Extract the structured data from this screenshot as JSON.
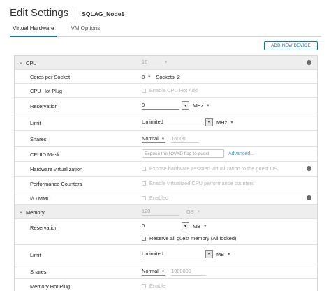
{
  "header": {
    "title": "Edit Settings",
    "vm_name": "SQLAG_Node1"
  },
  "tabs": [
    {
      "label": "Virtual Hardware",
      "active": true
    },
    {
      "label": "VM Options",
      "active": false
    }
  ],
  "add_device_label": "ADD NEW DEVICE",
  "cpu": {
    "section_label": "CPU",
    "count": "16",
    "cores_label": "Cores per Socket",
    "cores_value": "8",
    "sockets_text": "Sockets: 2",
    "hotplug_label": "CPU Hot Plug",
    "hotplug_text": "Enable CPU Hot Add",
    "reservation_label": "Reservation",
    "reservation_value": "0",
    "reservation_unit": "MHz",
    "limit_label": "Limit",
    "limit_value": "Unlimited",
    "limit_unit": "MHz",
    "shares_label": "Shares",
    "shares_value": "Normal",
    "shares_number": "16000",
    "cpuid_label": "CPUID Mask",
    "cpuid_text": "Expose the NX/XD flag to guest",
    "cpuid_link": "Advanced...",
    "hwvirt_label": "Hardware virtualization",
    "hwvirt_text": "Expose hardware assisted virtualization to the guest OS",
    "perf_label": "Performance Counters",
    "perf_text": "Enable virtualized CPU performance counters",
    "iommu_label": "I/O MMU",
    "iommu_text": "Enabled"
  },
  "memory": {
    "section_label": "Memory",
    "size": "128",
    "size_unit": "GB",
    "reservation_label": "Reservation",
    "reservation_value": "0",
    "reservation_unit": "MB",
    "reserve_all_text": "Reserve all guest memory (All locked)",
    "limit_label": "Limit",
    "limit_value": "Unlimited",
    "limit_unit": "MB",
    "shares_label": "Shares",
    "shares_value": "Normal",
    "shares_number": "1000000",
    "hotplug_label": "Memory Hot Plug",
    "hotplug_text": "Enable"
  },
  "icons": {
    "info": "i",
    "chevron_down": "⌄",
    "chevron_right": "›",
    "caret": "▾"
  }
}
